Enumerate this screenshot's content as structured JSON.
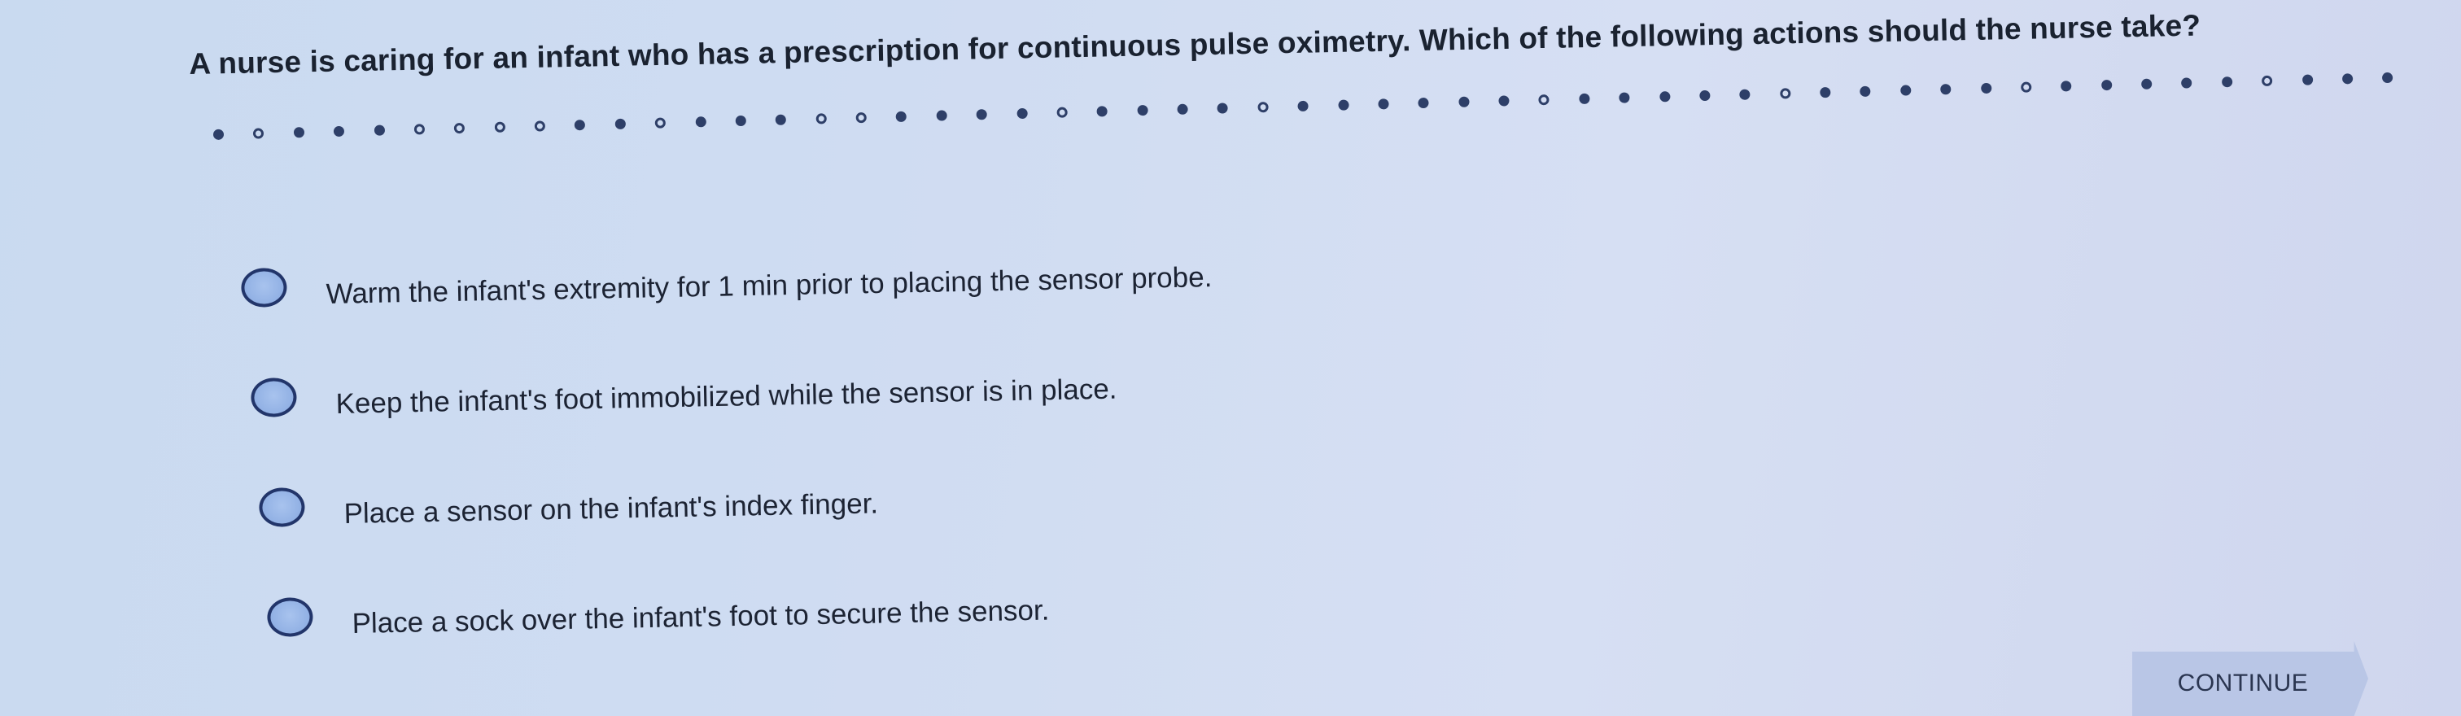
{
  "question": {
    "text": "A nurse is caring for an infant who has a prescription for continuous pulse oximetry. Which of the following actions should the nurse take?"
  },
  "progress": {
    "dots": [
      "filled",
      "open",
      "filled",
      "filled",
      "filled",
      "open",
      "open",
      "open",
      "open",
      "filled",
      "filled",
      "open",
      "filled",
      "filled",
      "filled",
      "open",
      "open",
      "filled",
      "filled",
      "filled",
      "filled",
      "open",
      "filled",
      "filled",
      "filled",
      "filled",
      "open",
      "filled",
      "filled",
      "filled",
      "filled",
      "filled",
      "filled",
      "open",
      "filled",
      "filled",
      "filled",
      "filled",
      "filled",
      "open",
      "filled",
      "filled",
      "filled",
      "filled",
      "filled",
      "open",
      "filled",
      "filled",
      "filled",
      "filled",
      "filled",
      "open",
      "filled",
      "filled",
      "filled"
    ]
  },
  "options": [
    {
      "label": "Warm the infant's extremity for 1 min prior to placing the sensor probe.",
      "selected": false
    },
    {
      "label": "Keep the infant's foot immobilized while the sensor is in place.",
      "selected": false
    },
    {
      "label": "Place a sensor on the infant's index finger.",
      "selected": false
    },
    {
      "label": "Place a sock over the infant's foot to secure the sensor.",
      "selected": false
    }
  ],
  "continue_button": {
    "label": "CONTINUE"
  }
}
